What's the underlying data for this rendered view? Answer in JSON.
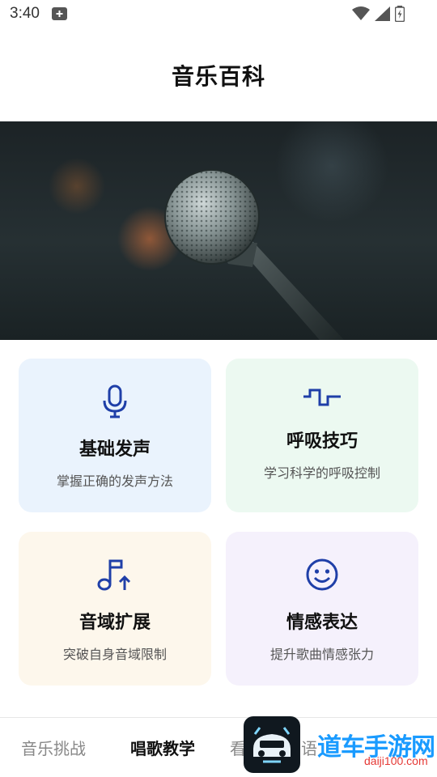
{
  "status_bar": {
    "time": "3:40",
    "icons": [
      "notification-plus-icon",
      "wifi-icon",
      "signal-icon",
      "battery-icon"
    ]
  },
  "header": {
    "title": "音乐百科"
  },
  "hero": {
    "image": "microphone-photo"
  },
  "cards": [
    {
      "title": "基础发声",
      "subtitle": "掌握正确的发声方法",
      "icon": "microphone-icon",
      "bg": "#eaf3fd"
    },
    {
      "title": "呼吸技巧",
      "subtitle": "学习科学的呼吸控制",
      "icon": "wave-icon",
      "bg": "#ecf9f1"
    },
    {
      "title": "音域扩展",
      "subtitle": "突破自身音域限制",
      "icon": "music-note-up-icon",
      "bg": "#fdf7ec"
    },
    {
      "title": "情感表达",
      "subtitle": "提升歌曲情感张力",
      "icon": "smile-icon",
      "bg": "#f5f1fc"
    }
  ],
  "bottom_nav": {
    "items": [
      {
        "label": "音乐挑战",
        "active": false
      },
      {
        "label": "唱歌教学",
        "active": true
      },
      {
        "label": "看",
        "active": false
      },
      {
        "label": "语",
        "active": false
      }
    ]
  },
  "overlay": {
    "watermark": "道车手游网",
    "watermark_url": "daiji100.com"
  },
  "colors": {
    "accent": "#1f3fa8",
    "active_text": "#111111",
    "inactive_text": "#888888"
  }
}
